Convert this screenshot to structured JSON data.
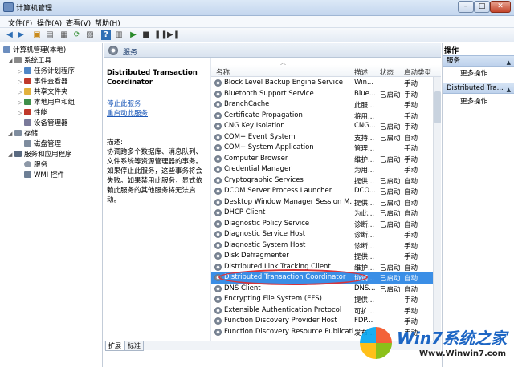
{
  "window": {
    "title": "计算机管理"
  },
  "menu": [
    "文件(F)",
    "操作(A)",
    "查看(V)",
    "帮助(H)"
  ],
  "tree": [
    {
      "label": "计算机管理(本地)",
      "level": 0,
      "icon": "computer-icon"
    },
    {
      "label": "系统工具",
      "level": 1,
      "icon": "tools-icon"
    },
    {
      "label": "任务计划程序",
      "level": 2,
      "icon": "clock-icon"
    },
    {
      "label": "事件查看器",
      "level": 2,
      "icon": "event-icon"
    },
    {
      "label": "共享文件夹",
      "level": 2,
      "icon": "folder-icon"
    },
    {
      "label": "本地用户和组",
      "level": 2,
      "icon": "users-icon"
    },
    {
      "label": "性能",
      "level": 2,
      "icon": "performance-icon"
    },
    {
      "label": "设备管理器",
      "level": 2,
      "icon": "device-icon"
    },
    {
      "label": "存储",
      "level": 1,
      "icon": "storage-icon"
    },
    {
      "label": "磁盘管理",
      "level": 2,
      "icon": "disk-icon"
    },
    {
      "label": "服务和应用程序",
      "level": 1,
      "icon": "services-apps-icon"
    },
    {
      "label": "服务",
      "level": 2,
      "icon": "gear-icon"
    },
    {
      "label": "WMI 控件",
      "level": 2,
      "icon": "wmi-icon"
    }
  ],
  "center": {
    "title": "服务",
    "selected_service": "Distributed Transaction Coordinator",
    "stop_link": "停止此服务",
    "restart_link": "重启动此服务",
    "desc_label": "描述:",
    "desc_text": "协调跨多个数据库、消息队列、文件系统等资源管理器的事务。如果停止此服务，这些事务将会失败。如果禁用此服务，显式依赖此服务的其他服务将无法启动。"
  },
  "list": {
    "columns": [
      "名称",
      "描述",
      "状态",
      "启动类型"
    ],
    "rows": [
      [
        "Block Level Backup Engine Service",
        "Win...",
        "",
        "手动"
      ],
      [
        "Bluetooth Support Service",
        "Blue...",
        "已启动",
        "手动"
      ],
      [
        "BranchCache",
        "此服...",
        "",
        "手动"
      ],
      [
        "Certificate Propagation",
        "将用...",
        "",
        "手动"
      ],
      [
        "CNG Key Isolation",
        "CNG...",
        "已启动",
        "手动"
      ],
      [
        "COM+ Event System",
        "支持...",
        "已启动",
        "自动"
      ],
      [
        "COM+ System Application",
        "管理...",
        "",
        "手动"
      ],
      [
        "Computer Browser",
        "维护...",
        "已启动",
        "手动"
      ],
      [
        "Credential Manager",
        "为用...",
        "",
        "手动"
      ],
      [
        "Cryptographic Services",
        "提供...",
        "已启动",
        "自动"
      ],
      [
        "DCOM Server Process Launcher",
        "DCO...",
        "已启动",
        "自动"
      ],
      [
        "Desktop Window Manager Session M...",
        "提供...",
        "已启动",
        "自动"
      ],
      [
        "DHCP Client",
        "为此...",
        "已启动",
        "自动"
      ],
      [
        "Diagnostic Policy Service",
        "诊断...",
        "已启动",
        "自动"
      ],
      [
        "Diagnostic Service Host",
        "诊断...",
        "",
        "手动"
      ],
      [
        "Diagnostic System Host",
        "诊断...",
        "",
        "手动"
      ],
      [
        "Disk Defragmenter",
        "提供...",
        "",
        "手动"
      ],
      [
        "Distributed Link Tracking Client",
        "维护...",
        "已启动",
        "自动"
      ],
      [
        "Distributed Transaction Coordinator",
        "协调...",
        "已启动",
        "自动"
      ],
      [
        "DNS Client",
        "DNS...",
        "已启动",
        "自动"
      ],
      [
        "Encrypting File System (EFS)",
        "提供...",
        "",
        "手动"
      ],
      [
        "Extensible Authentication Protocol",
        "可扩...",
        "",
        "手动"
      ],
      [
        "Function Discovery Provider Host",
        "FDP...",
        "",
        "手动"
      ],
      [
        "Function Discovery Resource Publication",
        "发布...",
        "",
        "手动"
      ]
    ],
    "selected_index": 18
  },
  "tabs": [
    "扩展",
    "标准"
  ],
  "actions": {
    "title": "操作",
    "sections": [
      {
        "label": "服务",
        "item": "更多操作"
      },
      {
        "label": "Distributed Tra...",
        "item": "更多操作"
      }
    ]
  },
  "watermark": {
    "brand": "Win7系统之家",
    "url": "Www.Winwin7.com"
  },
  "colors": {
    "selection": "#3a8ee6",
    "highlight": "#d9333a",
    "link": "#1a57b8"
  }
}
